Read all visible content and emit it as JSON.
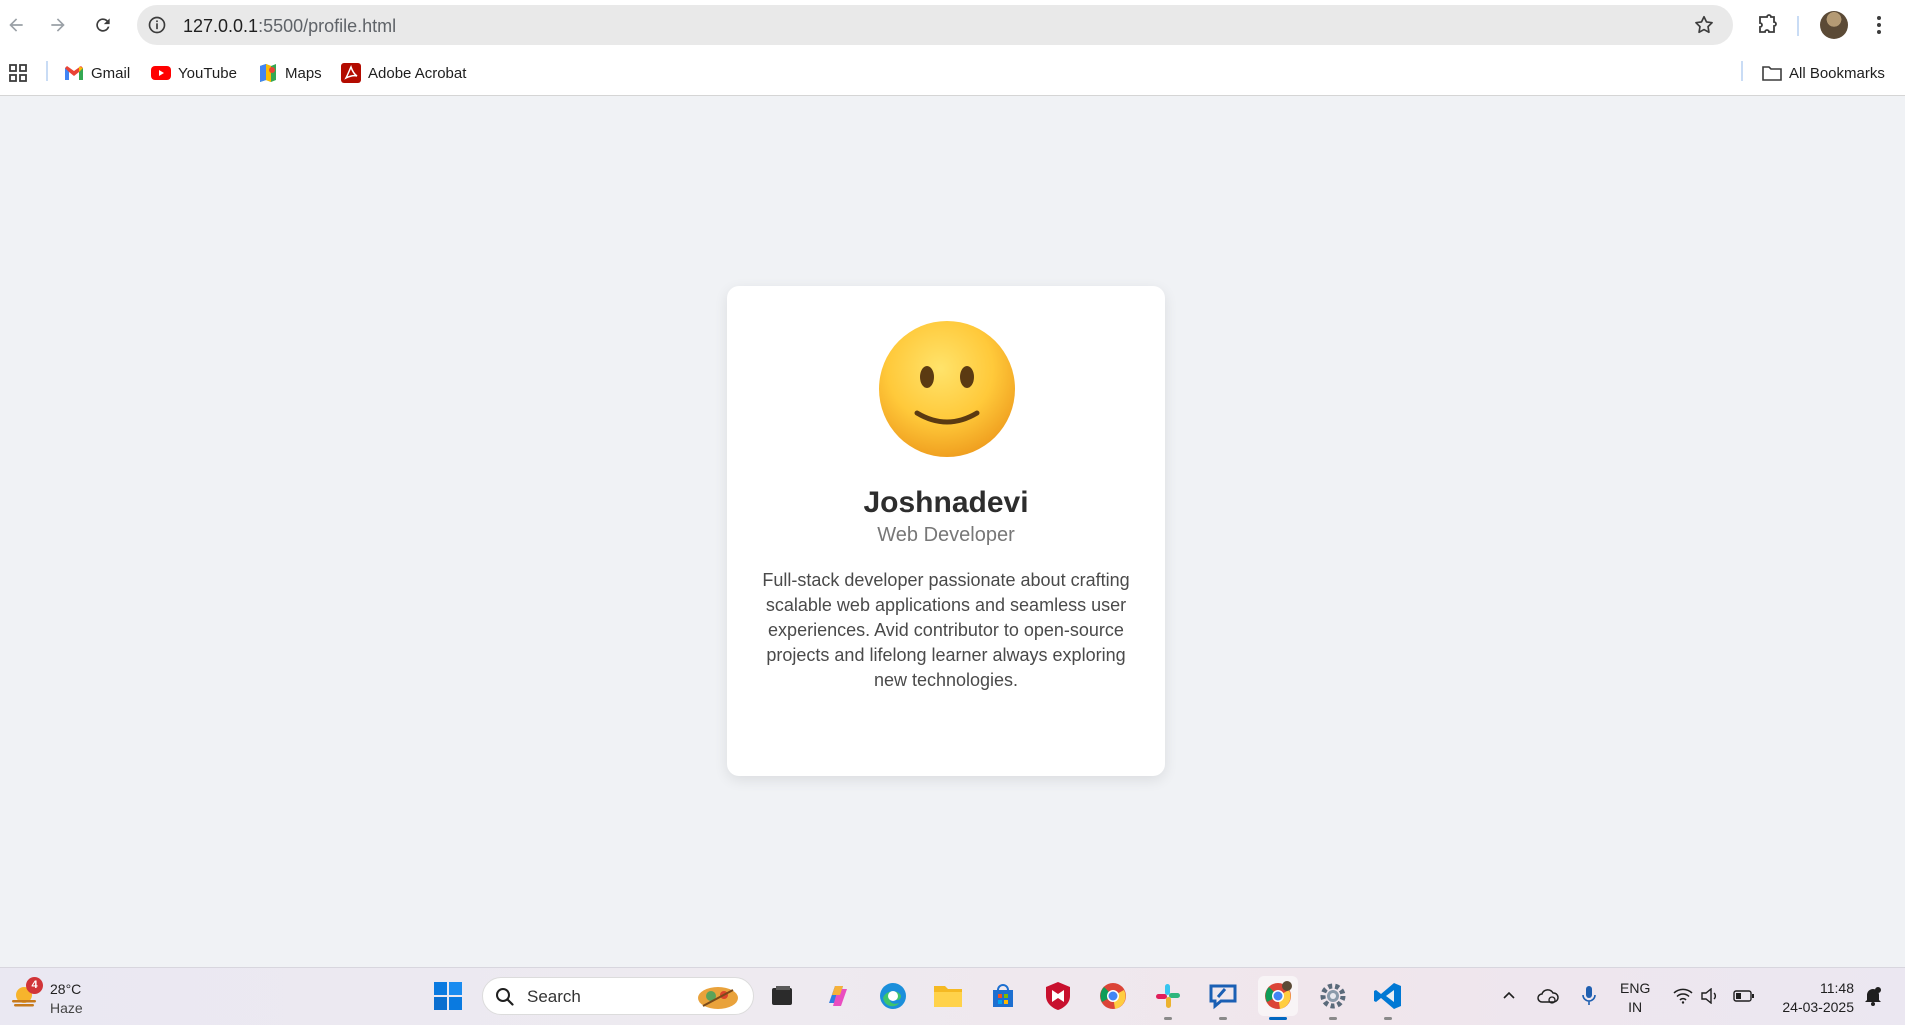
{
  "browser": {
    "url_host": "127.0.0.1",
    "url_path": ":5500/profile.html",
    "bookmarks": [
      {
        "label": "Gmail",
        "icon": "gmail-icon"
      },
      {
        "label": "YouTube",
        "icon": "youtube-icon"
      },
      {
        "label": "Maps",
        "icon": "maps-icon"
      },
      {
        "label": "Adobe Acrobat",
        "icon": "acrobat-icon"
      }
    ],
    "all_bookmarks": "All Bookmarks"
  },
  "profile": {
    "avatar_emoji": "slightly-smiling-face",
    "name": "Joshnadevi",
    "role": "Web Developer",
    "bio": "Full-stack developer passionate about crafting scalable web applications and seamless user experiences. Avid contributor to open-source projects and lifelong learner always exploring new technologies."
  },
  "taskbar": {
    "weather": {
      "badge": "4",
      "temp": "28°C",
      "condition": "Haze"
    },
    "search_placeholder": "Search",
    "apps": [
      "start",
      "file-explorer-dark",
      "copilot",
      "edge",
      "file-explorer",
      "microsoft-store",
      "mcafee",
      "chrome",
      "slack",
      "quick-assist",
      "chrome-active",
      "settings",
      "vscode"
    ],
    "lang_top": "ENG",
    "lang_bottom": "IN",
    "time": "11:48",
    "date": "24-03-2025"
  },
  "colors": {
    "page_bg": "#f0f2f5",
    "card_bg": "#ffffff",
    "name": "#2d2d2d",
    "role": "#777777",
    "bio": "#4a4a4a"
  }
}
